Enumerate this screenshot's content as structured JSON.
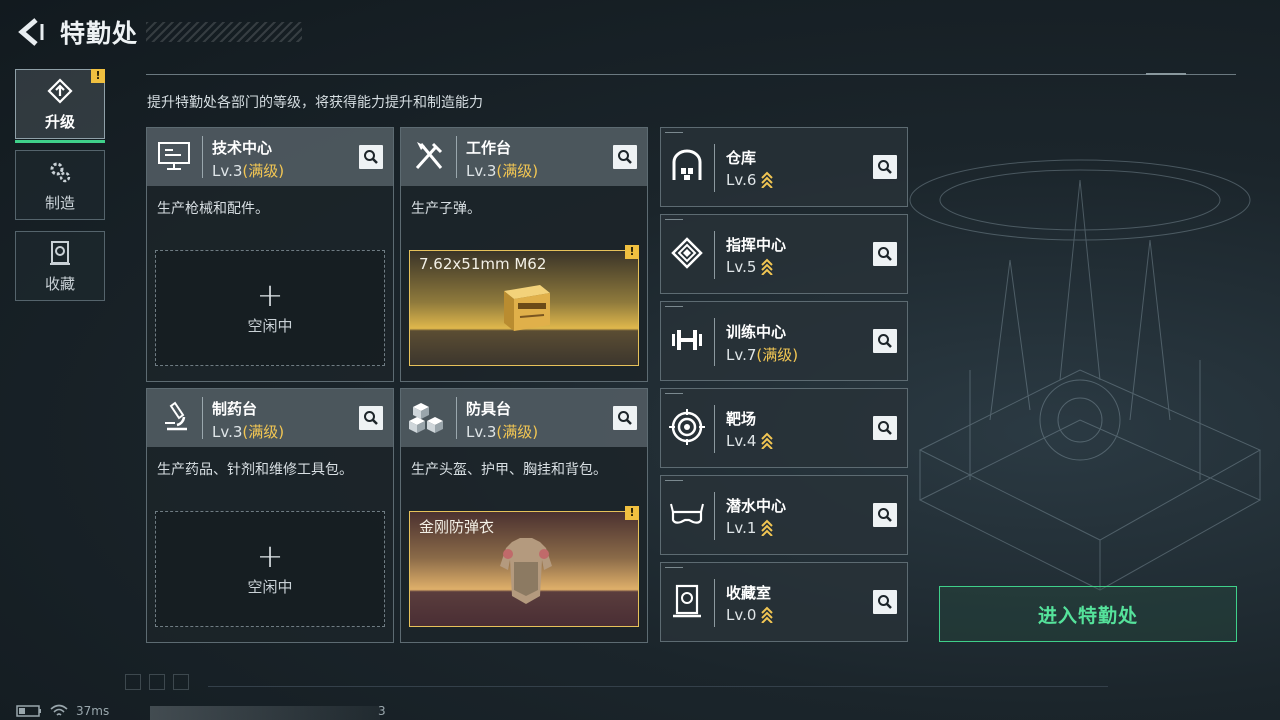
{
  "header": {
    "title": "特勤处"
  },
  "tabs": [
    {
      "label": "升级",
      "active": true,
      "warning": "!"
    },
    {
      "label": "制造",
      "active": false
    },
    {
      "label": "收藏",
      "active": false
    }
  ],
  "subtitle": "提升特勤处各部门的等级，将获得能力提升和制造能力",
  "cards": [
    {
      "name": "技术中心",
      "level": "Lv.3",
      "max": "(满级)",
      "desc": "生产枪械和配件。",
      "slot_status": "空闲中",
      "icon": "monitor-icon"
    },
    {
      "name": "工作台",
      "level": "Lv.3",
      "max": "(满级)",
      "desc": "生产子弹。",
      "slot_item": "7.62x51mm M62",
      "warning": "!",
      "icon": "tools-icon"
    },
    {
      "name": "制药台",
      "level": "Lv.3",
      "max": "(满级)",
      "desc": "生产药品、针剂和维修工具包。",
      "slot_status": "空闲中",
      "icon": "microscope-icon"
    },
    {
      "name": "防具台",
      "level": "Lv.3",
      "max": "(满级)",
      "desc": "生产头盔、护甲、胸挂和背包。",
      "slot_item": "金刚防弹衣",
      "warning": "!",
      "icon": "cubes-icon"
    }
  ],
  "facilities": [
    {
      "name": "仓库",
      "level": "Lv.6",
      "max": "",
      "upgradable": true,
      "icon": "warehouse-icon"
    },
    {
      "name": "指挥中心",
      "level": "Lv.5",
      "max": "",
      "upgradable": true,
      "icon": "chip-icon"
    },
    {
      "name": "训练中心",
      "level": "Lv.7",
      "max": "(满级)",
      "upgradable": false,
      "icon": "dumbbell-icon"
    },
    {
      "name": "靶场",
      "level": "Lv.4",
      "max": "",
      "upgradable": true,
      "icon": "target-icon"
    },
    {
      "name": "潜水中心",
      "level": "Lv.1",
      "max": "",
      "upgradable": true,
      "icon": "goggles-icon"
    },
    {
      "name": "收藏室",
      "level": "Lv.0",
      "max": "",
      "upgradable": true,
      "icon": "vault-icon"
    }
  ],
  "enter_button": "进入特勤处",
  "status": {
    "ping": "37ms",
    "counter": "3"
  },
  "colors": {
    "accent": "#3fd08a",
    "max_level": "#f2c653",
    "warning": "#f0c040"
  }
}
